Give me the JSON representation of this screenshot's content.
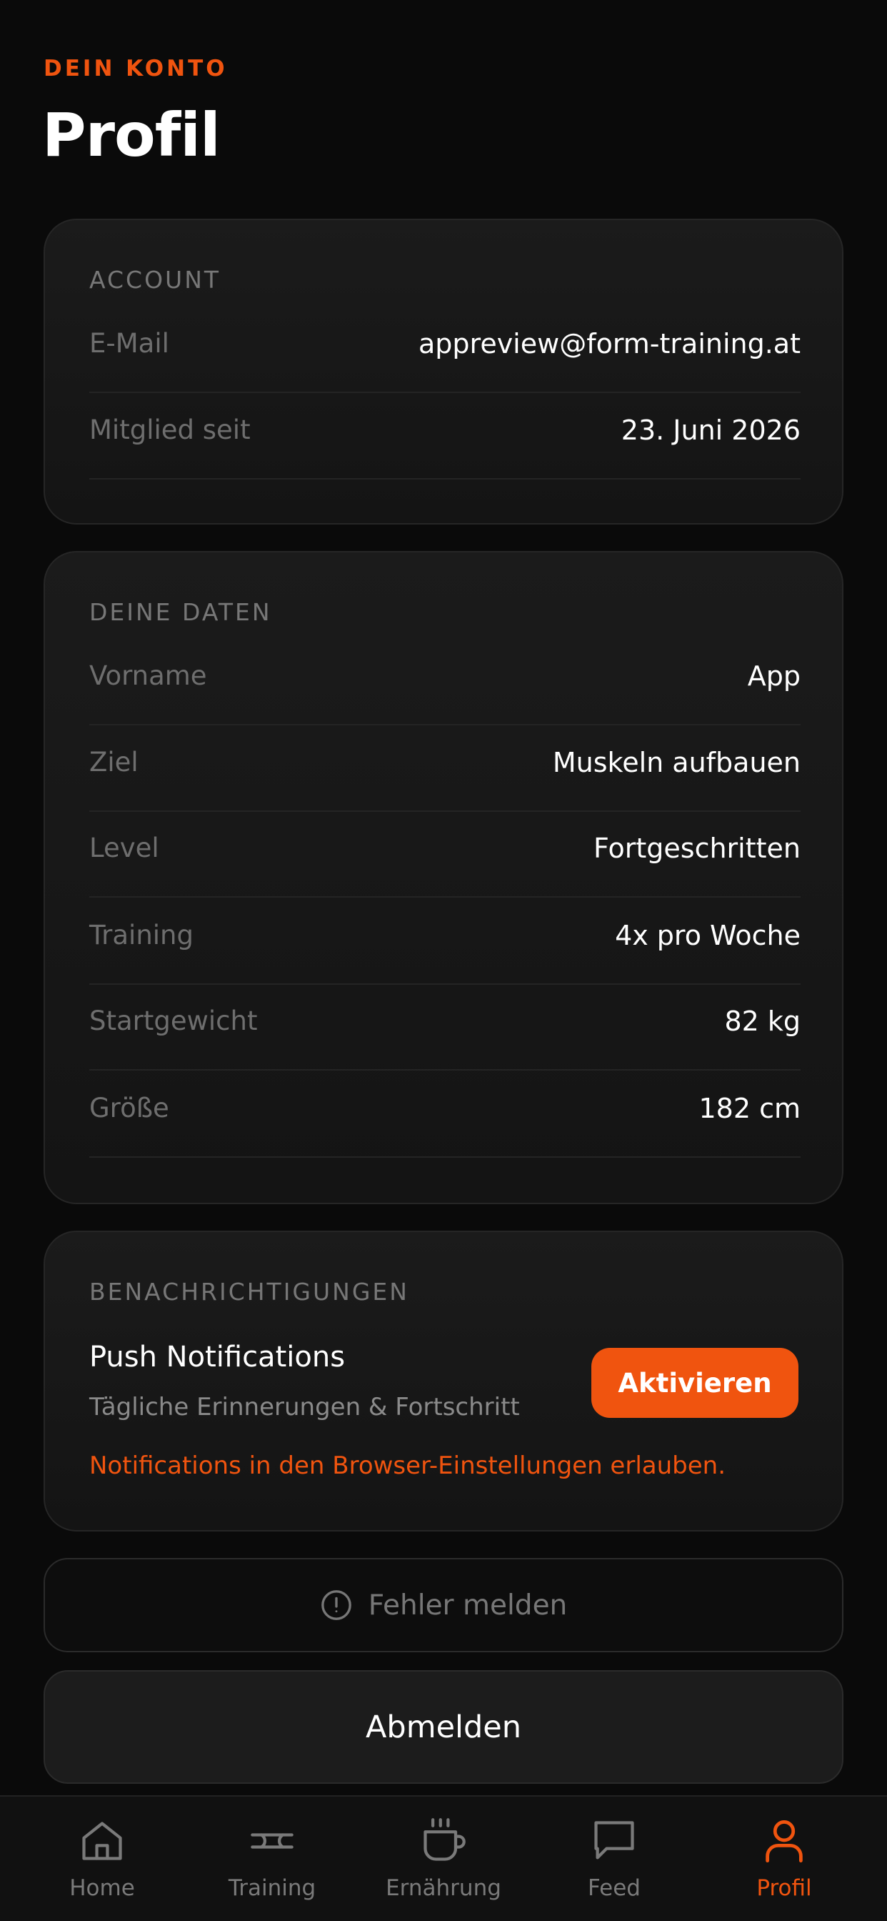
{
  "header": {
    "eyebrow": "DEIN KONTO",
    "title": "Profil"
  },
  "account": {
    "section_label": "ACCOUNT",
    "rows": [
      {
        "label": "E-Mail",
        "value": "appreview@form-training.at"
      },
      {
        "label": "Mitglied seit",
        "value": "23. Juni 2026"
      }
    ]
  },
  "data": {
    "section_label": "DEINE DATEN",
    "rows": [
      {
        "label": "Vorname",
        "value": "App"
      },
      {
        "label": "Ziel",
        "value": "Muskeln aufbauen"
      },
      {
        "label": "Level",
        "value": "Fortgeschritten"
      },
      {
        "label": "Training",
        "value": "4x pro Woche"
      },
      {
        "label": "Startgewicht",
        "value": "82 kg"
      },
      {
        "label": "Größe",
        "value": "182 cm"
      }
    ]
  },
  "notifications": {
    "section_label": "BENACHRICHTIGUNGEN",
    "title": "Push Notifications",
    "subtitle": "Tägliche Erinnerungen & Fortschritt",
    "button_label": "Aktivieren",
    "warning": "Notifications in den Browser-Einstellungen erlauben."
  },
  "actions": {
    "report_label": "Fehler melden",
    "report_icon": "alert-circle-icon",
    "logout_label": "Abmelden"
  },
  "tabbar": {
    "active": "Profil",
    "tabs": [
      {
        "label": "Home",
        "icon": "home-icon"
      },
      {
        "label": "Training",
        "icon": "training-icon"
      },
      {
        "label": "Ernährung",
        "icon": "cup-icon"
      },
      {
        "label": "Feed",
        "icon": "chat-bubble-icon"
      },
      {
        "label": "Profil",
        "icon": "user-icon"
      }
    ]
  },
  "colors": {
    "accent": "#f0540f",
    "background": "#0a0a0a",
    "card": "#1a1a1a",
    "muted_text": "#6e6e6e"
  }
}
